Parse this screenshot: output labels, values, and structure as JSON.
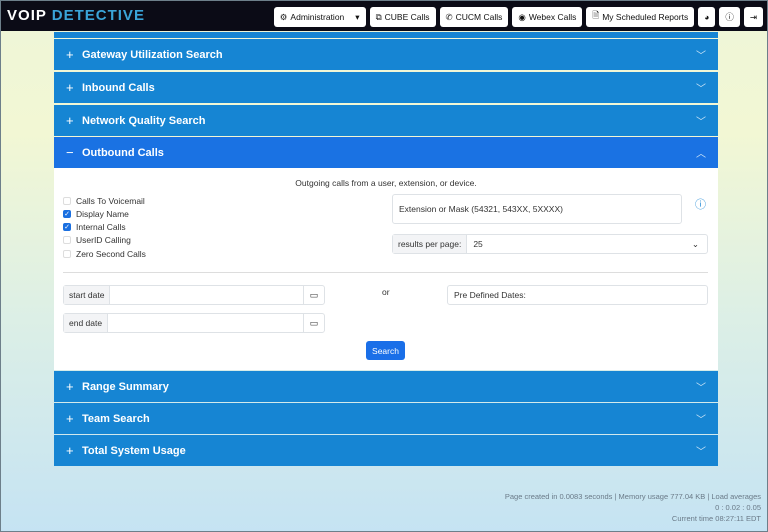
{
  "header": {
    "logo": {
      "v": "V",
      "o": "O",
      "ip": "IP",
      "detective": "DETECTIVE"
    },
    "nav": [
      {
        "label": "Administration",
        "icon": "gear-icon"
      },
      {
        "label": "CUBE Calls",
        "icon": "cube-icon"
      },
      {
        "label": "CUCM Calls",
        "icon": "phone-icon"
      },
      {
        "label": "Webex Calls",
        "icon": "record-icon"
      },
      {
        "label": "My Scheduled Reports",
        "icon": "report-icon"
      }
    ]
  },
  "panels": {
    "gateway": "Gateway Utilization Search",
    "inbound": "Inbound Calls",
    "network": "Network Quality Search",
    "outbound": "Outbound Calls",
    "range": "Range Summary",
    "team": "Team Search",
    "total": "Total System Usage"
  },
  "outbound": {
    "description": "Outgoing calls from a user, extension, or device.",
    "options": [
      {
        "label": "Calls To Voicemail",
        "checked": false
      },
      {
        "label": "Display Name",
        "checked": true
      },
      {
        "label": "Internal Calls",
        "checked": true
      },
      {
        "label": "UserID Calling",
        "checked": false
      },
      {
        "label": "Zero Second Calls",
        "checked": false
      }
    ],
    "extension_placeholder": "Extension or Mask (54321, 543XX, 5XXXX)",
    "results_label": "results per page:",
    "results_value": "25",
    "start_date_label": "start date",
    "end_date_label": "end date",
    "or": "or",
    "predefined_placeholder": "Pre Defined Dates:",
    "search": "Search"
  },
  "footer": {
    "line1": "Page created in 0.0083 seconds | Memory usage 777.04 KB | Load averages",
    "line2": "0 : 0.02 : 0.05",
    "line3": "Current time 08:27:11 EDT"
  }
}
